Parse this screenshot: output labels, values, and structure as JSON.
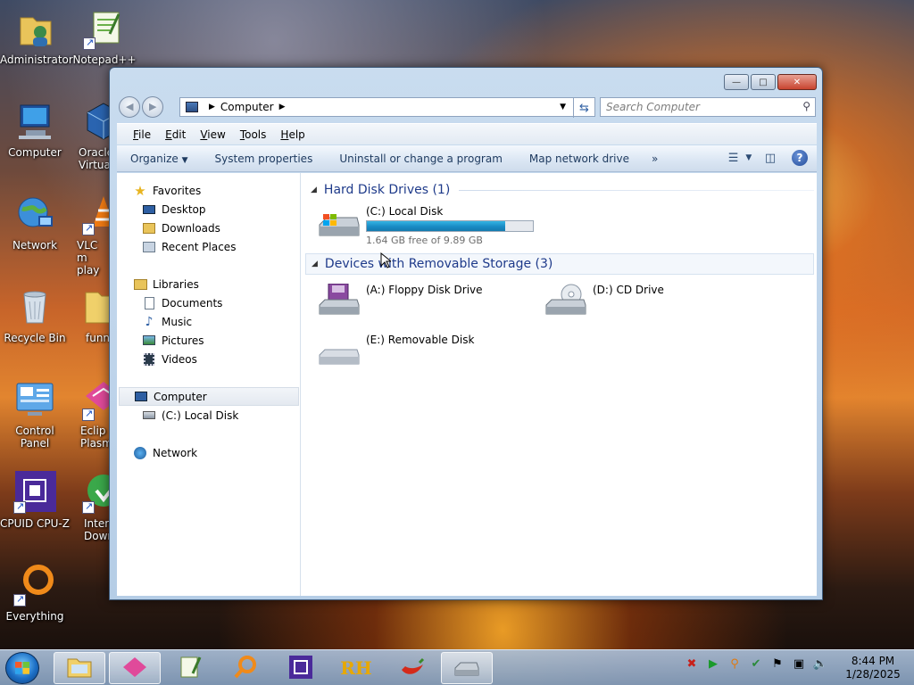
{
  "desktop": {
    "icons": [
      {
        "label": "Administrator"
      },
      {
        "label": "Notepad++"
      },
      {
        "label": "Computer"
      },
      {
        "label": "Oracle Virtua"
      },
      {
        "label": "Network"
      },
      {
        "label": "VLC m play"
      },
      {
        "label": "Recycle Bin"
      },
      {
        "label": "funn"
      },
      {
        "label": "Control Panel"
      },
      {
        "label": "Eclip Plasm"
      },
      {
        "label": "CPUID CPU-Z"
      },
      {
        "label": "Inter Down"
      },
      {
        "label": "Everything"
      }
    ]
  },
  "window": {
    "address": "Computer",
    "search_placeholder": "Search Computer",
    "menu": [
      "File",
      "Edit",
      "View",
      "Tools",
      "Help"
    ],
    "toolbar": {
      "organize": "Organize",
      "system_properties": "System properties",
      "uninstall": "Uninstall or change a program",
      "map_drive": "Map network drive",
      "more": "»"
    },
    "nav": {
      "favorites": "Favorites",
      "desktop": "Desktop",
      "downloads": "Downloads",
      "recent": "Recent Places",
      "libraries": "Libraries",
      "documents": "Documents",
      "music": "Music",
      "pictures": "Pictures",
      "videos": "Videos",
      "computer": "Computer",
      "local_disk": "(C:) Local Disk",
      "network": "Network"
    },
    "groups": {
      "hdd": "Hard Disk Drives (1)",
      "removable": "Devices with Removable Storage (3)"
    },
    "drives": {
      "c": {
        "name": "(C:) Local Disk",
        "free": "1.64 GB free of 9.89 GB",
        "used_fraction": 0.834
      },
      "a": {
        "name": "(A:) Floppy Disk Drive"
      },
      "d": {
        "name": "(D:) CD Drive"
      },
      "e": {
        "name": "(E:) Removable Disk"
      }
    }
  },
  "taskbar": {
    "time": "8:44 PM",
    "date": "1/28/2025"
  }
}
